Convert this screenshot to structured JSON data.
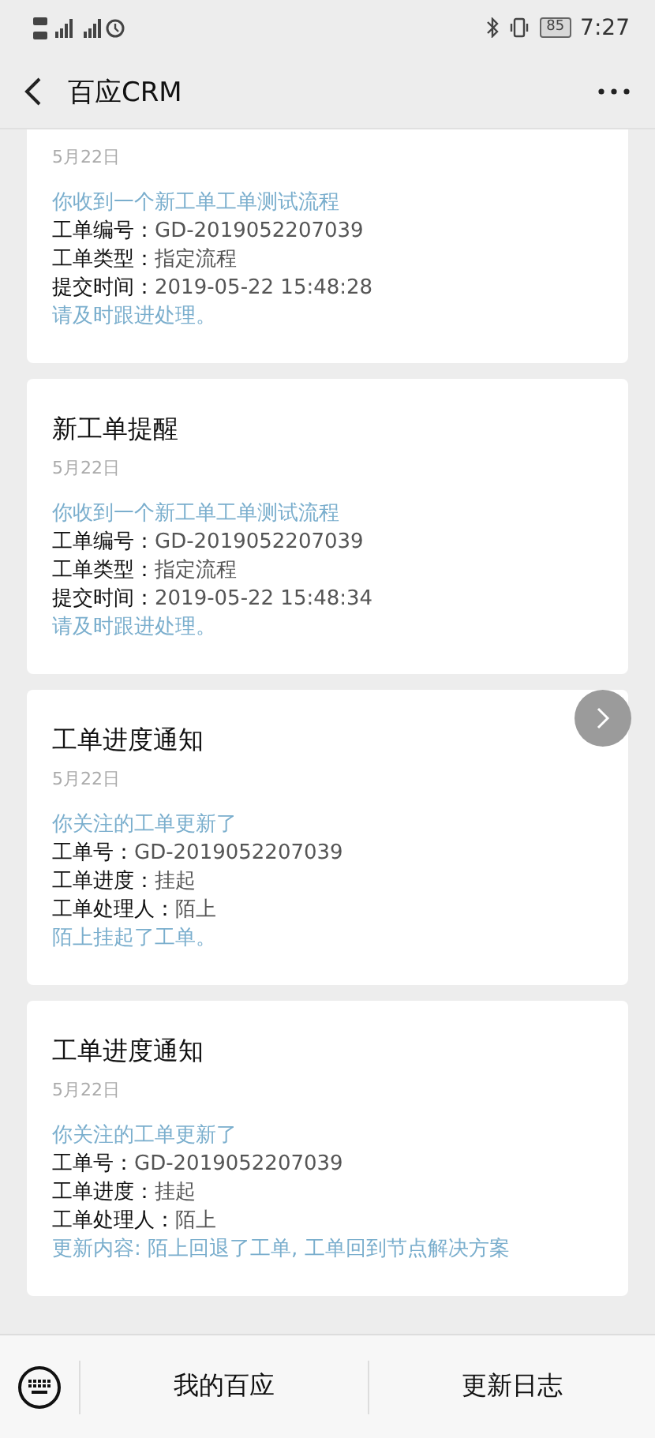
{
  "status_bar": {
    "battery": "85",
    "time": "7:27"
  },
  "header": {
    "title": "百应CRM"
  },
  "cards": [
    {
      "date": "5月22日",
      "lines": [
        {
          "kind": "link",
          "text": "你收到一个新工单工单测试流程"
        },
        {
          "kind": "field",
          "label": "工单编号：",
          "value": "GD-2019052207039"
        },
        {
          "kind": "field",
          "label": "工单类型：",
          "value": "指定流程"
        },
        {
          "kind": "field",
          "label": "提交时间：",
          "value": "2019-05-22 15:48:28"
        },
        {
          "kind": "link",
          "text": "请及时跟进处理。"
        }
      ]
    },
    {
      "title": "新工单提醒",
      "date": "5月22日",
      "lines": [
        {
          "kind": "link",
          "text": "你收到一个新工单工单测试流程"
        },
        {
          "kind": "field",
          "label": "工单编号：",
          "value": "GD-2019052207039"
        },
        {
          "kind": "field",
          "label": "工单类型：",
          "value": "指定流程"
        },
        {
          "kind": "field",
          "label": "提交时间：",
          "value": "2019-05-22 15:48:34"
        },
        {
          "kind": "link",
          "text": "请及时跟进处理。"
        }
      ]
    },
    {
      "title": "工单进度通知",
      "date": "5月22日",
      "lines": [
        {
          "kind": "link",
          "text": "你关注的工单更新了"
        },
        {
          "kind": "field",
          "label": "工单号：",
          "value": "GD-2019052207039"
        },
        {
          "kind": "field",
          "label": "工单进度：",
          "value": "挂起"
        },
        {
          "kind": "field",
          "label": "工单处理人：",
          "value": "陌上"
        },
        {
          "kind": "link",
          "text": "陌上挂起了工单。"
        }
      ]
    },
    {
      "title": "工单进度通知",
      "date": "5月22日",
      "lines": [
        {
          "kind": "link",
          "text": "你关注的工单更新了"
        },
        {
          "kind": "field",
          "label": "工单号：",
          "value": "GD-2019052207039"
        },
        {
          "kind": "field",
          "label": "工单进度：",
          "value": "挂起"
        },
        {
          "kind": "field",
          "label": "工单处理人：",
          "value": "陌上"
        },
        {
          "kind": "link",
          "text": "更新内容: 陌上回退了工单, 工单回到节点解决方案"
        }
      ]
    }
  ],
  "menu": [
    "我的百应",
    "更新日志"
  ]
}
